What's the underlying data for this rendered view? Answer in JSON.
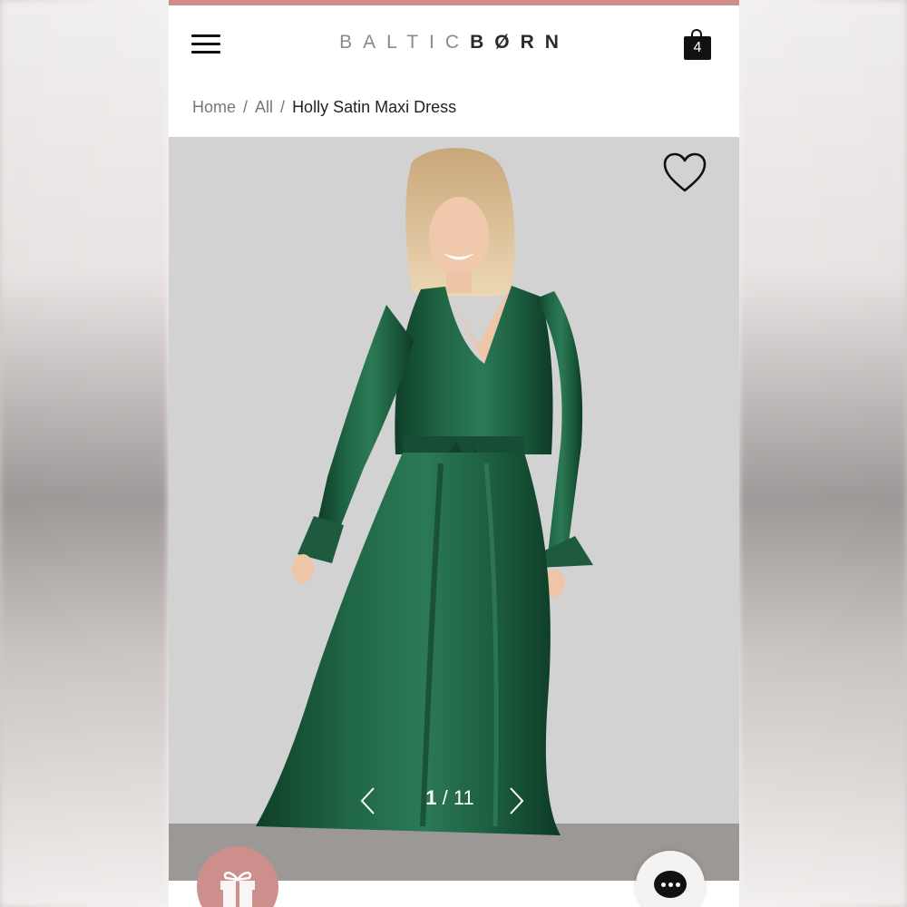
{
  "header": {
    "brand_part1": "BALTIC",
    "brand_part2": "BØRN",
    "cart_count": "4",
    "accent_color": "#cf8d8c"
  },
  "breadcrumb": {
    "items": [
      "Home",
      "All"
    ],
    "separator": "/",
    "current": "Holly Satin Maxi Dress"
  },
  "gallery": {
    "current_index": "1",
    "counter_sep": "/",
    "total": "11",
    "dress_color": "#1d5a3e",
    "wishlist_icon": "heart-outline-icon",
    "prev_icon": "chevron-left-icon",
    "next_icon": "chevron-right-icon"
  },
  "floating": {
    "gift_icon": "gift-icon",
    "gift_color": "#cd8f8c",
    "chat_icon": "chat-bubble-icon"
  }
}
